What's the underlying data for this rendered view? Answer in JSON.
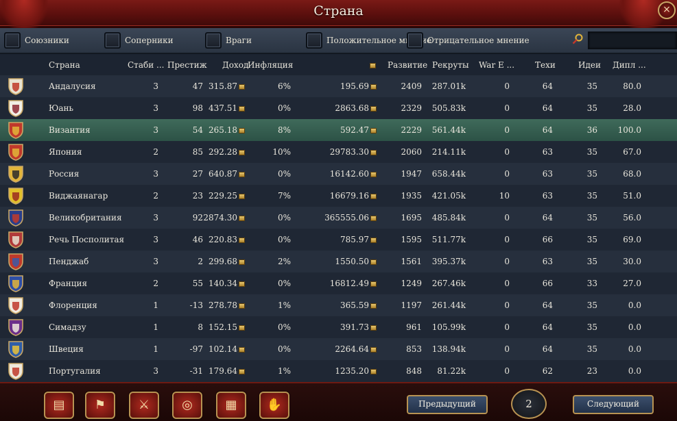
{
  "window": {
    "title": "Страна",
    "close": "×"
  },
  "filters": [
    {
      "label": "Союзники"
    },
    {
      "label": "Соперники"
    },
    {
      "label": "Враги"
    },
    {
      "label": "Положительное мнение"
    },
    {
      "label": "Отрицательное мнение"
    }
  ],
  "search": {
    "value": ""
  },
  "columns": {
    "country": "Страна",
    "stability": "Стаби ...",
    "prestige": "Престиж",
    "income": "Доход",
    "inflation": "Инфляция",
    "treasury_icon": "coin-icon",
    "development": "Развитие",
    "manpower": "Рекруты",
    "war_exhaustion": "War E ...",
    "tech": "Техи",
    "ideas": "Идеи",
    "diplomacy": "Дипл ..."
  },
  "rows": [
    {
      "name": "Андалусия",
      "stability": "3",
      "prestige": "47",
      "income": "315.87",
      "inflation": "6%",
      "treasury": "195.69",
      "development": "2409",
      "manpower": "287.01k",
      "war_exhaustion": "0",
      "tech": "64",
      "ideas": "35",
      "diplomacy": "80.0",
      "flag_colors": [
        "#e9e3d2",
        "#c0392b"
      ]
    },
    {
      "name": "Юань",
      "stability": "3",
      "prestige": "98",
      "income": "437.51",
      "inflation": "0%",
      "treasury": "2863.68",
      "development": "2329",
      "manpower": "505.83k",
      "war_exhaustion": "0",
      "tech": "64",
      "ideas": "35",
      "diplomacy": "28.0",
      "flag_colors": [
        "#f2efe6",
        "#8e2a35"
      ]
    },
    {
      "name": "Византия",
      "stability": "3",
      "prestige": "54",
      "income": "265.18",
      "inflation": "8%",
      "treasury": "592.47",
      "development": "2229",
      "manpower": "561.44k",
      "war_exhaustion": "0",
      "tech": "64",
      "ideas": "36",
      "diplomacy": "100.0",
      "flag_colors": [
        "#c0392b",
        "#e2b53a"
      ],
      "selected": true
    },
    {
      "name": "Япония",
      "stability": "2",
      "prestige": "85",
      "income": "292.28",
      "inflation": "10%",
      "treasury": "29783.30",
      "development": "2060",
      "manpower": "214.11k",
      "war_exhaustion": "0",
      "tech": "63",
      "ideas": "35",
      "diplomacy": "67.0",
      "flag_colors": [
        "#c0392b",
        "#e2b53a"
      ]
    },
    {
      "name": "Россия",
      "stability": "3",
      "prestige": "27",
      "income": "640.87",
      "inflation": "0%",
      "treasury": "16142.60",
      "development": "1947",
      "manpower": "658.44k",
      "war_exhaustion": "0",
      "tech": "63",
      "ideas": "35",
      "diplomacy": "68.0",
      "flag_colors": [
        "#e2b53a",
        "#2b2b2b"
      ]
    },
    {
      "name": "Виджаянагар",
      "stability": "2",
      "prestige": "23",
      "income": "229.25",
      "inflation": "7%",
      "treasury": "16679.16",
      "development": "1935",
      "manpower": "421.05k",
      "war_exhaustion": "10",
      "tech": "63",
      "ideas": "35",
      "diplomacy": "51.0",
      "flag_colors": [
        "#e2c02b",
        "#9b2a1f"
      ]
    },
    {
      "name": "Великобритания",
      "stability": "3",
      "prestige": "92",
      "income": "2874.30",
      "inflation": "0%",
      "treasury": "365555.06",
      "development": "1695",
      "manpower": "485.84k",
      "war_exhaustion": "0",
      "tech": "64",
      "ideas": "35",
      "diplomacy": "56.0",
      "flag_colors": [
        "#2a3e8a",
        "#c0392b"
      ]
    },
    {
      "name": "Речь Посполитая",
      "stability": "3",
      "prestige": "46",
      "income": "220.83",
      "inflation": "0%",
      "treasury": "785.97",
      "development": "1595",
      "manpower": "511.77k",
      "war_exhaustion": "0",
      "tech": "66",
      "ideas": "35",
      "diplomacy": "69.0",
      "flag_colors": [
        "#b03a3a",
        "#e8e0d0"
      ]
    },
    {
      "name": "Пенджаб",
      "stability": "3",
      "prestige": "2",
      "income": "299.68",
      "inflation": "2%",
      "treasury": "1550.50",
      "development": "1561",
      "manpower": "395.37k",
      "war_exhaustion": "0",
      "tech": "63",
      "ideas": "35",
      "diplomacy": "30.0",
      "flag_colors": [
        "#c0392b",
        "#3b5ba8"
      ]
    },
    {
      "name": "Франция",
      "stability": "2",
      "prestige": "55",
      "income": "140.34",
      "inflation": "0%",
      "treasury": "16812.49",
      "development": "1249",
      "manpower": "267.46k",
      "war_exhaustion": "0",
      "tech": "66",
      "ideas": "33",
      "diplomacy": "27.0",
      "flag_colors": [
        "#2e4ea6",
        "#e2b53a"
      ]
    },
    {
      "name": "Флоренция",
      "stability": "1",
      "prestige": "-13",
      "income": "278.78",
      "inflation": "1%",
      "treasury": "365.59",
      "development": "1197",
      "manpower": "261.44k",
      "war_exhaustion": "0",
      "tech": "64",
      "ideas": "35",
      "diplomacy": "0.0",
      "flag_colors": [
        "#f1ece0",
        "#c0392b"
      ]
    },
    {
      "name": "Симадзу",
      "stability": "1",
      "prestige": "8",
      "income": "152.15",
      "inflation": "0%",
      "treasury": "391.73",
      "development": "961",
      "manpower": "105.99k",
      "war_exhaustion": "0",
      "tech": "64",
      "ideas": "35",
      "diplomacy": "0.0",
      "flag_colors": [
        "#6b2f8a",
        "#efe8dc"
      ]
    },
    {
      "name": "Швеция",
      "stability": "1",
      "prestige": "-97",
      "income": "102.14",
      "inflation": "0%",
      "treasury": "2264.64",
      "development": "853",
      "manpower": "138.94k",
      "war_exhaustion": "0",
      "tech": "64",
      "ideas": "35",
      "diplomacy": "0.0",
      "flag_colors": [
        "#2f5ea8",
        "#e9c23a"
      ]
    },
    {
      "name": "Португалия",
      "stability": "3",
      "prestige": "-31",
      "income": "179.64",
      "inflation": "1%",
      "treasury": "1235.20",
      "development": "848",
      "manpower": "81.22k",
      "war_exhaustion": "0",
      "tech": "62",
      "ideas": "23",
      "diplomacy": "0.0",
      "flag_colors": [
        "#eee8dc",
        "#c0392b"
      ]
    }
  ],
  "bottom": {
    "icons": [
      "ledger-icon",
      "flags-icon",
      "crossed-swords-icon",
      "coins-icon",
      "buildings-icon",
      "handshake-icon"
    ],
    "prev_label": "Предыдущий",
    "page": "2",
    "next_label": "Следующий"
  },
  "colors": {
    "accent": "#b89352",
    "selected_row": "#3f6a5a",
    "title_bar": "#5b0f0d"
  }
}
